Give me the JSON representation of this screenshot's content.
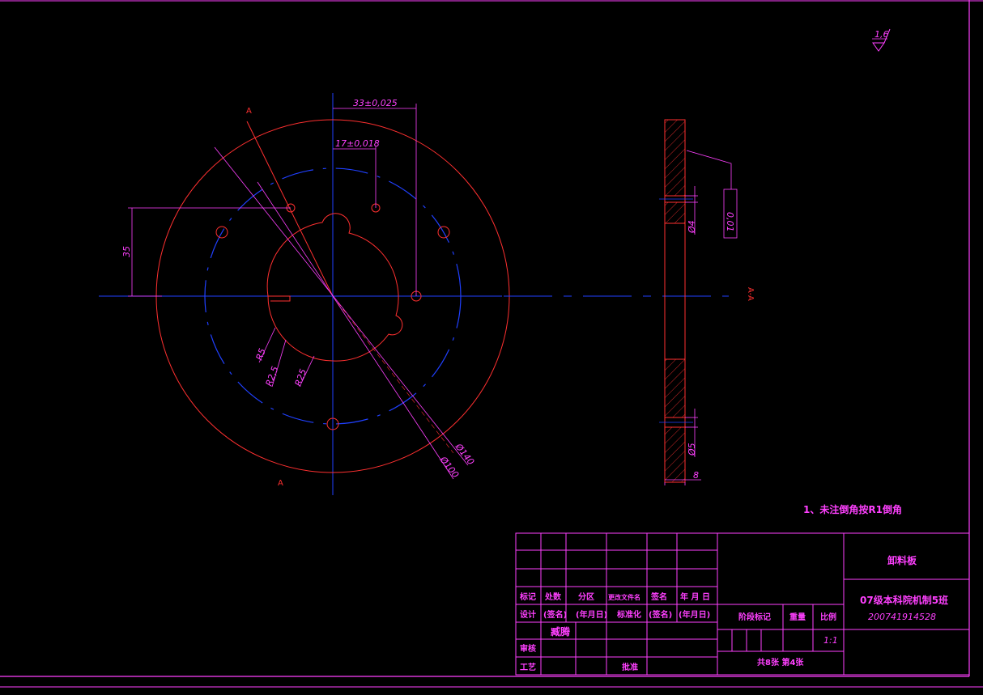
{
  "dimensions": {
    "d_33": "33±0,025",
    "d_17": "17±0,018",
    "d_35": "35",
    "r5": "R5",
    "r25a": "R2,5",
    "r25b": "R25",
    "phi140": "Ø140",
    "phi100": "Ø100",
    "phi4": "Ø4",
    "phi5": "Ø5",
    "thick8": "8",
    "flatness": "0,01",
    "roughness": "1,6"
  },
  "section": {
    "mark_top": "A",
    "mark_bottom": "A",
    "label": "A-A"
  },
  "note": "1、未注倒角按R1倒角",
  "title_block": {
    "part_name": "卸料板",
    "school": "07级本科院机制5班",
    "student_id": "200741914528",
    "scale": "1:1",
    "sheet_info": "共8张 第4张",
    "headers": [
      "标记",
      "处数",
      "分区",
      "更改文件名",
      "签名",
      "年 月 日"
    ],
    "row2": [
      "设计",
      "(签名)",
      "(年月日)",
      "标准化",
      "(签名)",
      "(年月日)"
    ],
    "designer": "臧腾",
    "review": "审核",
    "process": "工艺",
    "approve": "批准",
    "stage_mark": "阶段标记",
    "weight": "重量",
    "ratio": "比例"
  },
  "colors": {
    "outline": "#ff3030",
    "centerline": "#2040ff",
    "dimension": "#ff40ff",
    "frame": "#ff40ff",
    "background": "#000000"
  }
}
